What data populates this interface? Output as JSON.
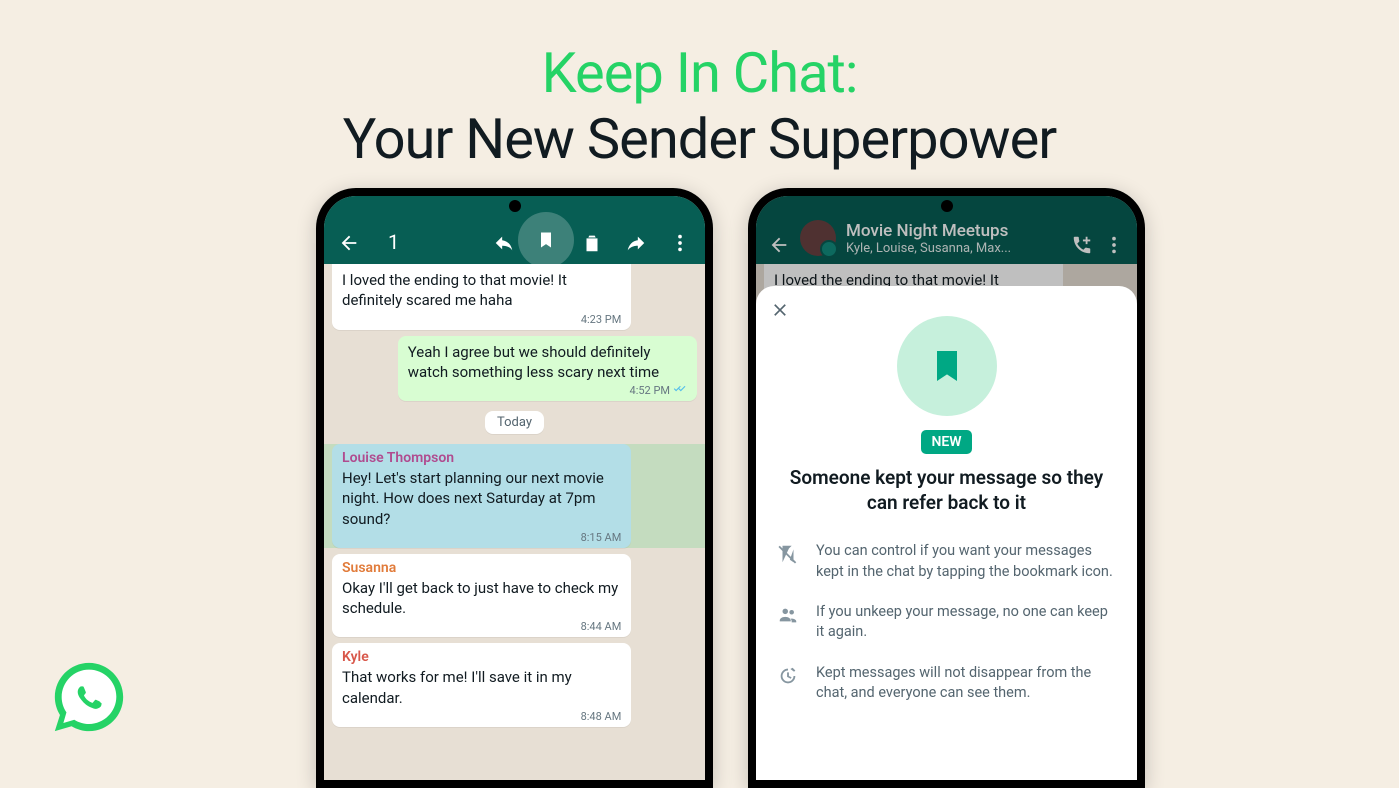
{
  "headline": {
    "line1": "Keep In Chat:",
    "line2": "Your New Sender Superpower"
  },
  "left_phone": {
    "selection_count": "1",
    "messages": {
      "m1": {
        "text": "I loved the ending to that movie! It definitely scared me haha",
        "time": "4:23 PM"
      },
      "m2": {
        "text": "Yeah I agree but we should definitely watch something less scary next time",
        "time": "4:52 PM"
      },
      "date_chip": "Today",
      "m3": {
        "sender": "Louise Thompson",
        "text": "Hey! Let's start planning our next movie night. How does next Saturday at 7pm sound?",
        "time": "8:15 AM"
      },
      "m4": {
        "sender": "Susanna",
        "text": "Okay I'll get back to just have to check my schedule.",
        "time": "8:44 AM"
      },
      "m5": {
        "sender": "Kyle",
        "text": "That works for me! I'll save it in my calendar.",
        "time": "8:48 AM"
      }
    }
  },
  "right_phone": {
    "header": {
      "title": "Movie Night Meetups",
      "members": "Kyle, Louise, Susanna, Max..."
    },
    "bg_msg": {
      "text": "I loved the ending to that movie! It definitely scared me haha"
    },
    "sheet": {
      "new_badge": "NEW",
      "title": "Someone kept your message so they can refer back to it",
      "rows": {
        "r1": "You can control if you want your messages kept in the chat by tapping the bookmark icon.",
        "r2": "If you unkeep your message, no one can keep it again.",
        "r3": "Kept messages will not disappear from the chat, and everyone can see them."
      }
    }
  }
}
